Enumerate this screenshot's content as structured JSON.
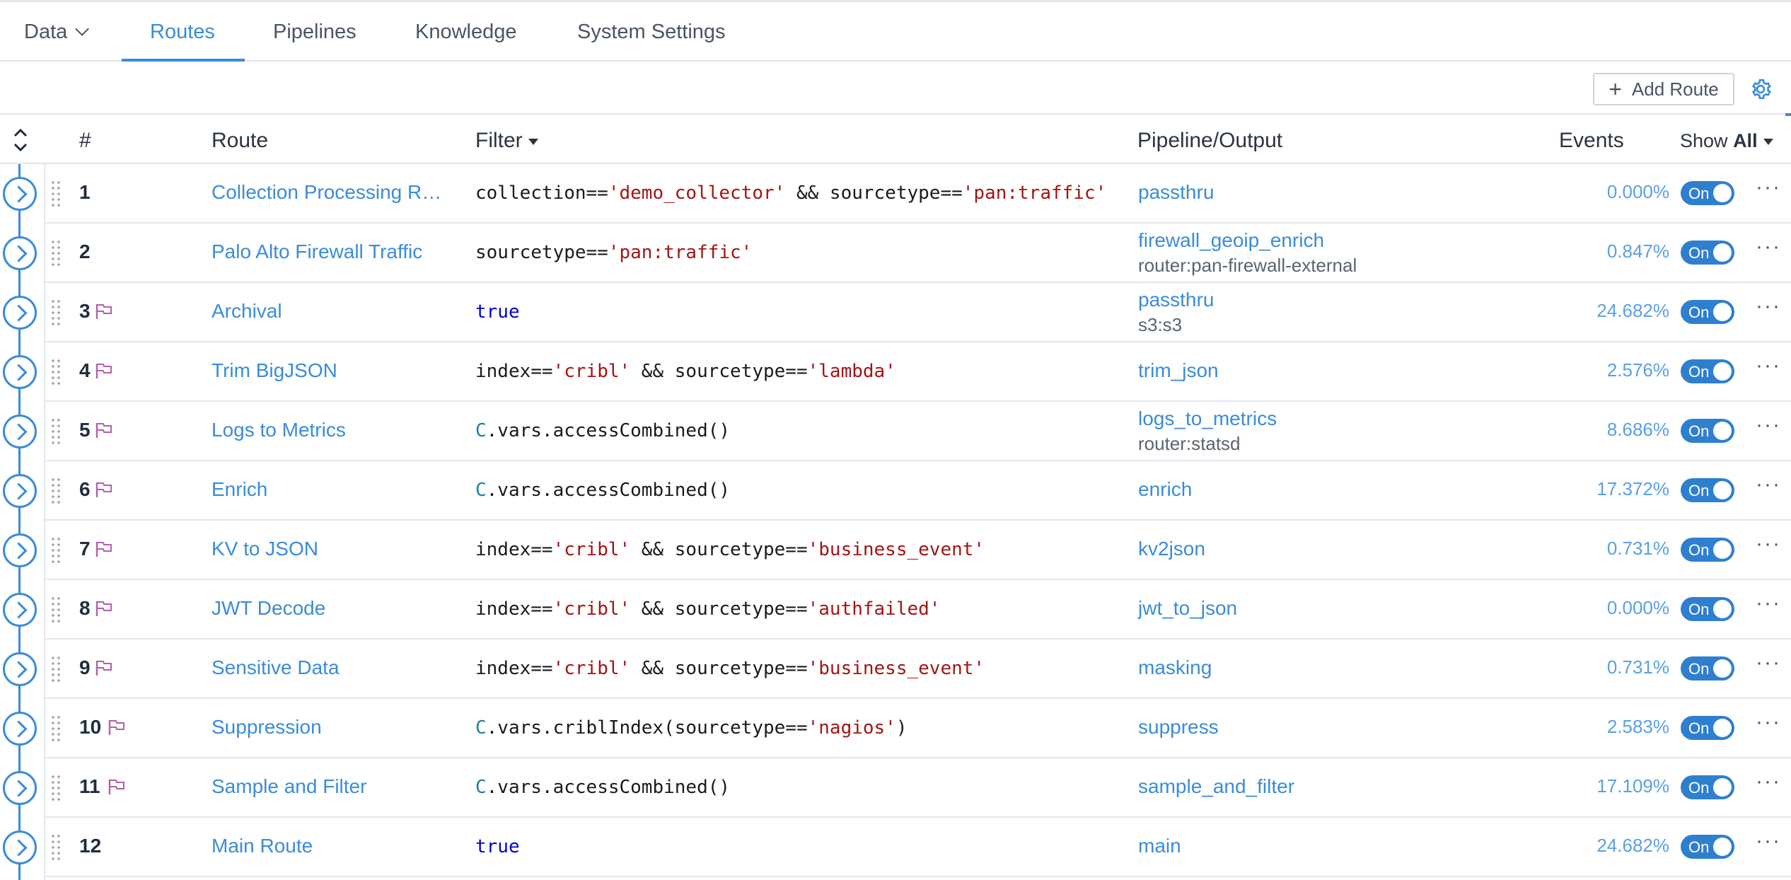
{
  "nav": {
    "data_label": "Data",
    "tabs": [
      {
        "label": "Routes"
      },
      {
        "label": "Pipelines"
      },
      {
        "label": "Knowledge"
      },
      {
        "label": "System Settings"
      }
    ]
  },
  "toolbar": {
    "add_route_label": "Add Route",
    "settings_icon": "gear-icon"
  },
  "table": {
    "headers": {
      "num": "#",
      "route": "Route",
      "filter": "Filter",
      "pipeline_output": "Pipeline/Output",
      "events": "Events",
      "show_prefix": "Show",
      "show_value": "All"
    },
    "rows": [
      {
        "num": "1",
        "flag": false,
        "route": "Collection Processing Rou...",
        "filter": [
          {
            "t": "collection=="
          },
          {
            "t": "'demo_collector'",
            "c": "str"
          },
          {
            "t": " && sourcetype=="
          },
          {
            "t": "'pan:traffic'",
            "c": "str"
          }
        ],
        "pipeline": "passthru",
        "output": "",
        "events": "0.000%",
        "toggle": "On"
      },
      {
        "num": "2",
        "flag": false,
        "route": "Palo Alto Firewall Traffic",
        "filter": [
          {
            "t": "sourcetype=="
          },
          {
            "t": "'pan:traffic'",
            "c": "str"
          }
        ],
        "pipeline": "firewall_geoip_enrich",
        "output": "router:pan-firewall-external",
        "events": "0.847%",
        "toggle": "On"
      },
      {
        "num": "3",
        "flag": true,
        "route": "Archival",
        "filter": [
          {
            "t": "true",
            "c": "bool"
          }
        ],
        "pipeline": "passthru",
        "output": "s3:s3",
        "events": "24.682%",
        "toggle": "On"
      },
      {
        "num": "4",
        "flag": true,
        "route": "Trim BigJSON",
        "filter": [
          {
            "t": "index=="
          },
          {
            "t": "'cribl'",
            "c": "str"
          },
          {
            "t": " && sourcetype=="
          },
          {
            "t": "'lambda'",
            "c": "str"
          }
        ],
        "pipeline": "trim_json",
        "output": "",
        "events": "2.576%",
        "toggle": "On"
      },
      {
        "num": "5",
        "flag": true,
        "route": "Logs to Metrics",
        "filter": [
          {
            "t": "C",
            "c": "c"
          },
          {
            "t": ".vars.accessCombined()"
          }
        ],
        "pipeline": "logs_to_metrics",
        "output": "router:statsd",
        "events": "8.686%",
        "toggle": "On"
      },
      {
        "num": "6",
        "flag": true,
        "route": "Enrich",
        "filter": [
          {
            "t": "C",
            "c": "c"
          },
          {
            "t": ".vars.accessCombined()"
          }
        ],
        "pipeline": "enrich",
        "output": "",
        "events": "17.372%",
        "toggle": "On"
      },
      {
        "num": "7",
        "flag": true,
        "route": "KV to JSON",
        "filter": [
          {
            "t": "index=="
          },
          {
            "t": "'cribl'",
            "c": "str"
          },
          {
            "t": " && sourcetype=="
          },
          {
            "t": "'business_event'",
            "c": "str"
          }
        ],
        "pipeline": "kv2json",
        "output": "",
        "events": "0.731%",
        "toggle": "On"
      },
      {
        "num": "8",
        "flag": true,
        "route": "JWT Decode",
        "filter": [
          {
            "t": "index=="
          },
          {
            "t": "'cribl'",
            "c": "str"
          },
          {
            "t": " && sourcetype=="
          },
          {
            "t": "'authfailed'",
            "c": "str"
          }
        ],
        "pipeline": "jwt_to_json",
        "output": "",
        "events": "0.000%",
        "toggle": "On"
      },
      {
        "num": "9",
        "flag": true,
        "route": "Sensitive Data",
        "filter": [
          {
            "t": "index=="
          },
          {
            "t": "'cribl'",
            "c": "str"
          },
          {
            "t": " && sourcetype=="
          },
          {
            "t": "'business_event'",
            "c": "str"
          }
        ],
        "pipeline": "masking",
        "output": "",
        "events": "0.731%",
        "toggle": "On"
      },
      {
        "num": "10",
        "flag": true,
        "route": "Suppression",
        "filter": [
          {
            "t": "C",
            "c": "c"
          },
          {
            "t": ".vars.criblIndex(sourcetype=="
          },
          {
            "t": "'nagios'",
            "c": "str"
          },
          {
            "t": ")"
          }
        ],
        "pipeline": "suppress",
        "output": "",
        "events": "2.583%",
        "toggle": "On"
      },
      {
        "num": "11",
        "flag": true,
        "route": "Sample and Filter",
        "filter": [
          {
            "t": "C",
            "c": "c"
          },
          {
            "t": ".vars.accessCombined()"
          }
        ],
        "pipeline": "sample_and_filter",
        "output": "",
        "events": "17.109%",
        "toggle": "On"
      },
      {
        "num": "12",
        "flag": false,
        "route": "Main Route",
        "filter": [
          {
            "t": "true",
            "c": "bool"
          }
        ],
        "pipeline": "main",
        "output": "",
        "events": "24.682%",
        "toggle": "On"
      }
    ]
  },
  "colors": {
    "accent": "#3a8cd9",
    "toggle_on": "#2f7fd0",
    "string_literal": "#a31515",
    "boolean_literal": "#0000cc",
    "flag_icon": "#b061a8"
  }
}
